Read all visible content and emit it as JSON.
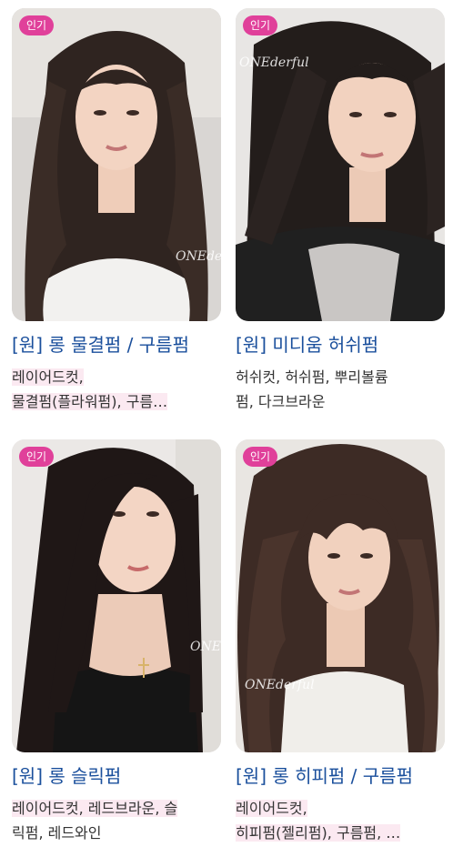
{
  "accent_color": "#e0409a",
  "title_color": "#1a4f9c",
  "cards": [
    {
      "badge": "인기",
      "title": "[원] 롱 물결펌 / 구름펌",
      "tags_line1": "레이어드컷,",
      "tags_line2": "물결펌(플라워펌), 구름…",
      "watermark": "ONEderful",
      "image": "woman-long-wavy-hair-photo"
    },
    {
      "badge": "인기",
      "title": "[원] 미디움 허쉬펌",
      "tags_line1": "허쉬컷, 허쉬펌, 뿌리볼륨",
      "tags_line2": "펌, 다크브라운",
      "watermark": "ONEderful",
      "image": "woman-medium-hush-cut-photo"
    },
    {
      "badge": "인기",
      "title": "[원] 롱 슬릭펌",
      "tags_line1": "레이어드컷, 레드브라운, 슬",
      "tags_line2": "릭펌, 레드와인",
      "watermark": "ONEderful",
      "image": "woman-long-sleek-hair-photo"
    },
    {
      "badge": "인기",
      "title": "[원] 롱 히피펌 / 구름펌",
      "tags_line1": "레이어드컷,",
      "tags_line2": "히피펌(젤리펌), 구름펌, …",
      "watermark": "ONEderful",
      "image": "woman-long-hippie-perm-photo"
    }
  ]
}
